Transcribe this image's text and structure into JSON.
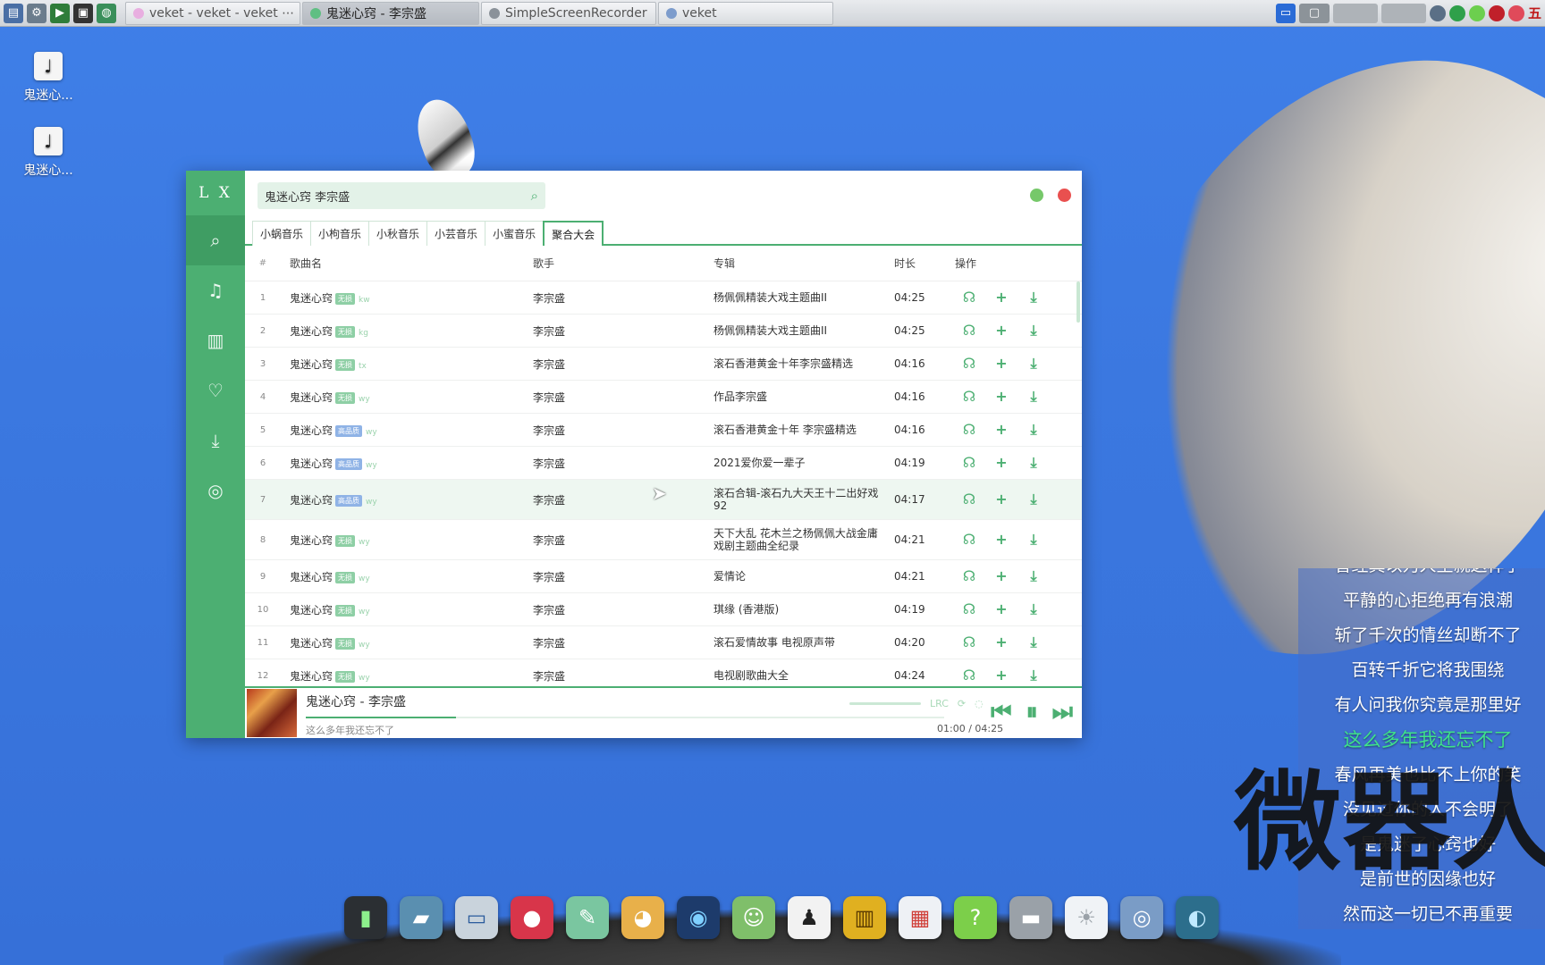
{
  "taskbar": {
    "tabs": [
      {
        "label": "veket - veket - veket ⋯",
        "active": false,
        "dot": "#e8aee0"
      },
      {
        "label": "鬼迷心窍 - 李宗盛",
        "active": true,
        "dot": "#5fbf83"
      },
      {
        "label": "SimpleScreenRecorder",
        "active": false,
        "dot": "#8a9199"
      },
      {
        "label": "veket",
        "active": false,
        "dot": "#7d9ccc"
      }
    ],
    "tray_ime": "五"
  },
  "desktop": {
    "icons": [
      {
        "label": "鬼迷心..."
      },
      {
        "label": "鬼迷心..."
      }
    ]
  },
  "app": {
    "logo": "L X",
    "search": {
      "value": "鬼迷心窍 李宗盛"
    },
    "sources": [
      "小蜗音乐",
      "小枸音乐",
      "小秋音乐",
      "小芸音乐",
      "小蜜音乐",
      "聚合大会"
    ],
    "active_source": 5,
    "headers": {
      "idx": "#",
      "name": "歌曲名",
      "singer": "歌手",
      "album": "专辑",
      "duration": "时长",
      "ops": "操作"
    },
    "rows": [
      {
        "idx": "1",
        "name": "鬼迷心窍",
        "tag": "无损",
        "src": "kw",
        "singer": "李宗盛",
        "album": "杨佩佩精装大戏主题曲II",
        "duration": "04:25"
      },
      {
        "idx": "2",
        "name": "鬼迷心窍",
        "tag": "无损",
        "src": "kg",
        "singer": "李宗盛",
        "album": "杨佩佩精装大戏主题曲II",
        "duration": "04:25"
      },
      {
        "idx": "3",
        "name": "鬼迷心窍",
        "tag": "无损",
        "src": "tx",
        "singer": "李宗盛",
        "album": "滚石香港黄金十年李宗盛精选",
        "duration": "04:16"
      },
      {
        "idx": "4",
        "name": "鬼迷心窍",
        "tag": "无损",
        "src": "wy",
        "singer": "李宗盛",
        "album": "作品李宗盛",
        "duration": "04:16"
      },
      {
        "idx": "5",
        "name": "鬼迷心窍",
        "tag": "高品质",
        "src": "wy",
        "singer": "李宗盛",
        "album": "滚石香港黄金十年 李宗盛精选",
        "duration": "04:16"
      },
      {
        "idx": "6",
        "name": "鬼迷心窍",
        "tag": "高品质",
        "src": "wy",
        "singer": "李宗盛",
        "album": "2021爱你爱一辈子",
        "duration": "04:19"
      },
      {
        "idx": "7",
        "name": "鬼迷心窍",
        "tag": "高品质",
        "src": "wy",
        "singer": "李宗盛",
        "album": "滚石合辑-滚石九大天王十二出好戏92",
        "duration": "04:17"
      },
      {
        "idx": "8",
        "name": "鬼迷心窍",
        "tag": "无损",
        "src": "wy",
        "singer": "李宗盛",
        "album": "天下大乱 花木兰之杨佩佩大战金庸戏剧主题曲全纪录",
        "duration": "04:21"
      },
      {
        "idx": "9",
        "name": "鬼迷心窍",
        "tag": "无损",
        "src": "wy",
        "singer": "李宗盛",
        "album": "爱情论",
        "duration": "04:21"
      },
      {
        "idx": "10",
        "name": "鬼迷心窍",
        "tag": "无损",
        "src": "wy",
        "singer": "李宗盛",
        "album": "琪缘 (香港版)",
        "duration": "04:19"
      },
      {
        "idx": "11",
        "name": "鬼迷心窍",
        "tag": "无损",
        "src": "wy",
        "singer": "李宗盛",
        "album": "滚石爱情故事 电视原声带",
        "duration": "04:20"
      },
      {
        "idx": "12",
        "name": "鬼迷心窍",
        "tag": "无损",
        "src": "wy",
        "singer": "李宗盛",
        "album": "电视剧歌曲大全",
        "duration": "04:24"
      }
    ],
    "player": {
      "title": "鬼迷心窍 - 李宗盛",
      "lyric": "这么多年我还忘不了",
      "lrc_label": "LRC",
      "current_time": "01:00",
      "separator": "/",
      "total_time": "04:25",
      "progress": 0.235
    }
  },
  "lyrics_overlay": {
    "lines": [
      {
        "text": "曾经真以为人生就这样了",
        "current": false
      },
      {
        "text": "平静的心拒绝再有浪潮",
        "current": false
      },
      {
        "text": "斩了千次的情丝却断不了",
        "current": false
      },
      {
        "text": "百转千折它将我围绕",
        "current": false
      },
      {
        "text": "有人问我你究竟是那里好",
        "current": false
      },
      {
        "text": "这么多年我还忘不了",
        "current": true
      },
      {
        "text": "春风再美也比不上你的笑",
        "current": false
      },
      {
        "text": "没见过你的人不会明了",
        "current": false
      },
      {
        "text": "是鬼迷了心窍也好",
        "current": false
      },
      {
        "text": "是前世的因缘也好",
        "current": false
      },
      {
        "text": "然而这一切已不再重要",
        "current": false
      }
    ],
    "watermark": "微器人"
  }
}
